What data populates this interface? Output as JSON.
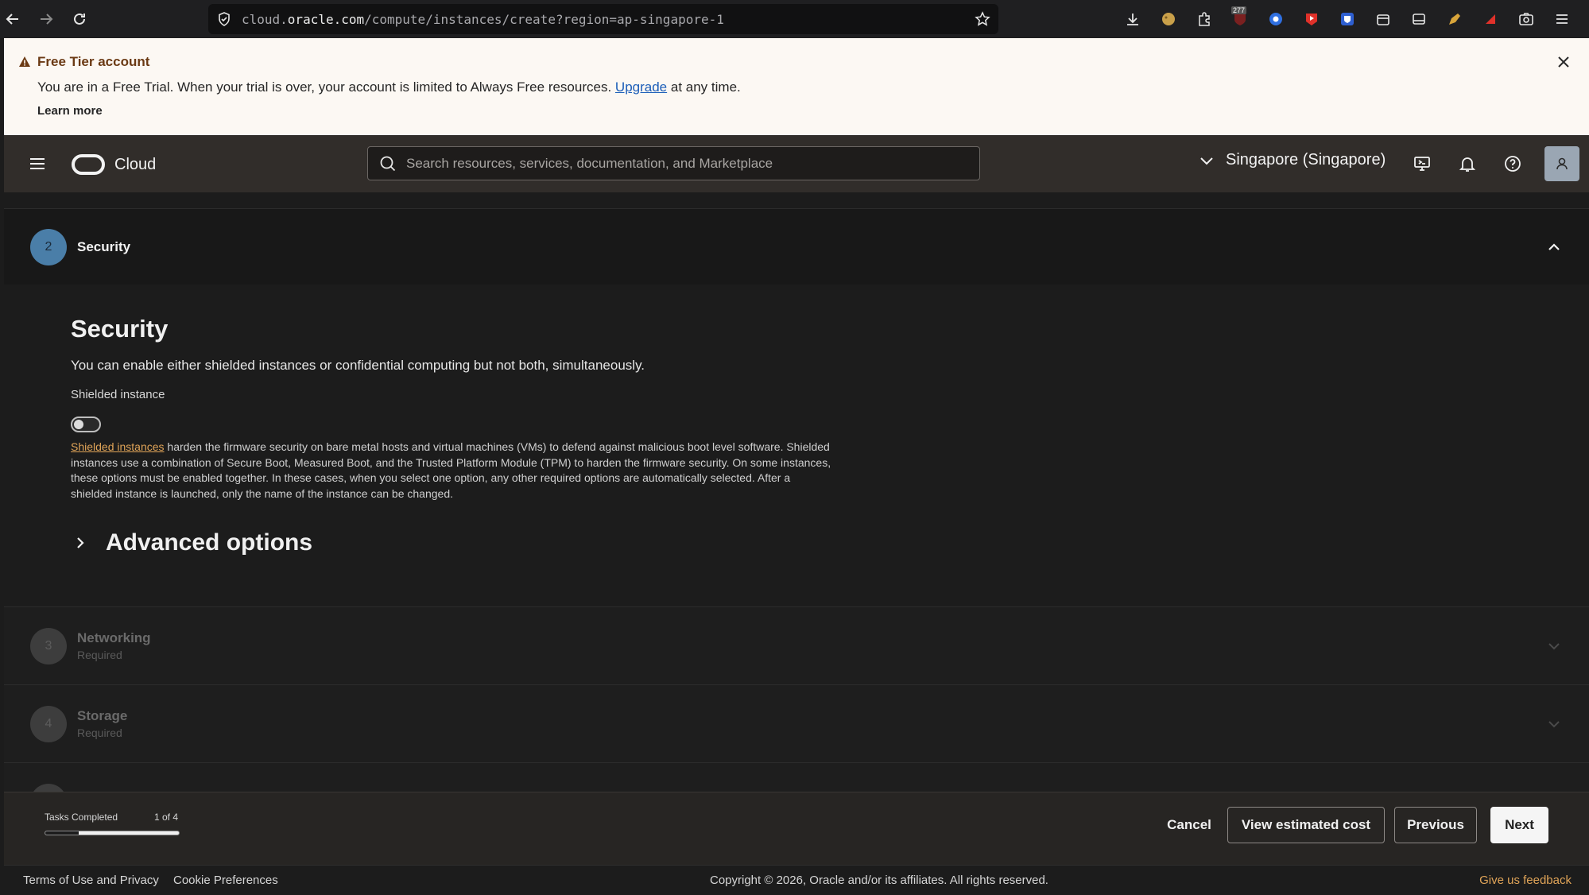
{
  "browser": {
    "url_prefix": "cloud.",
    "url_domain": "oracle.com",
    "url_path": "/compute/instances/create?region=ap-singapore-1",
    "extension_badge": "277"
  },
  "banner": {
    "title": "Free Tier account",
    "text_before": "You are in a Free Trial. When your trial is over, your account is limited to Always Free resources.",
    "link": "Upgrade",
    "text_after": "at any time.",
    "learn_more": "Learn more"
  },
  "topnav": {
    "brand": "Cloud",
    "search_placeholder": "Search resources, services, documentation, and Marketplace",
    "region": "Singapore (Singapore)"
  },
  "steps": [
    {
      "number": "2",
      "title": "Security",
      "subtitle": ""
    },
    {
      "number": "3",
      "title": "Networking",
      "subtitle": "Required"
    },
    {
      "number": "4",
      "title": "Storage",
      "subtitle": "Required"
    }
  ],
  "security": {
    "heading": "Security",
    "description": "You can enable either shielded instances or confidential computing but not both, simultaneously.",
    "shielded_label": "Shielded instance",
    "shielded_enabled": false,
    "help_link": "Shielded instances",
    "help_text": " harden the firmware security on bare metal hosts and virtual machines (VMs) to defend against malicious boot level software. Shielded instances use a combination of Secure Boot, Measured Boot, and the Trusted Platform Module (TPM) to harden the firmware security. On some instances, these options must be enabled together. In these cases, when you select one option, any other required options are automatically selected. After a shielded instance is launched, only the name of the instance can be changed.",
    "advanced_options": "Advanced options"
  },
  "actionbar": {
    "tasks_label": "Tasks Completed",
    "tasks_count": "1 of 4",
    "progress_fraction": 0.25,
    "cancel": "Cancel",
    "estimate": "View estimated cost",
    "previous": "Previous",
    "next": "Next"
  },
  "footer": {
    "terms": "Terms of Use and Privacy",
    "cookies": "Cookie Preferences",
    "copyright": "Copyright © 2026, Oracle and/or its affiliates. All rights reserved.",
    "feedback": "Give us feedback"
  },
  "colors": {
    "banner_bg": "#fcf8f3",
    "nav_bg": "#312d2a",
    "link_orange": "#e0a458",
    "step_active": "#4a7ea8"
  }
}
